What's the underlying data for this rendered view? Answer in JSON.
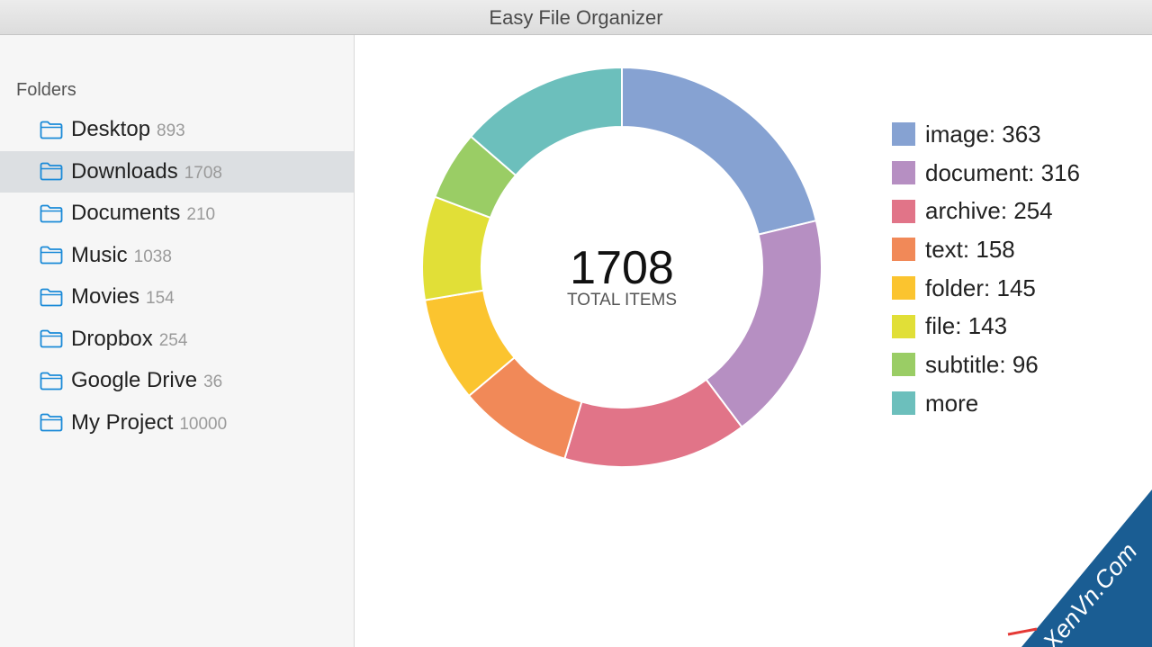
{
  "window": {
    "title": "Easy File Organizer"
  },
  "sidebar": {
    "header": "Folders",
    "folders": [
      {
        "name": "Desktop",
        "count": "893",
        "selected": false
      },
      {
        "name": "Downloads",
        "count": "1708",
        "selected": true
      },
      {
        "name": "Documents",
        "count": "210",
        "selected": false
      },
      {
        "name": "Music",
        "count": "1038",
        "selected": false
      },
      {
        "name": "Movies",
        "count": "154",
        "selected": false
      },
      {
        "name": "Dropbox",
        "count": "254",
        "selected": false
      },
      {
        "name": "Google Drive",
        "count": "36",
        "selected": false
      },
      {
        "name": "My Project",
        "count": "10000",
        "selected": false
      }
    ]
  },
  "summary": {
    "total": "1708",
    "label": "TOTAL ITEMS"
  },
  "chart_data": {
    "type": "pie",
    "variant": "donut",
    "center_value": "1708",
    "center_label": "TOTAL ITEMS",
    "categories": [
      "image",
      "document",
      "archive",
      "text",
      "folder",
      "file",
      "subtitle",
      "more"
    ],
    "values": [
      363,
      316,
      254,
      158,
      145,
      143,
      96,
      233
    ],
    "colors": [
      "#86a2d2",
      "#b68fc2",
      "#e17488",
      "#f18958",
      "#fbc42f",
      "#e1df37",
      "#9acd65",
      "#6cbfbc"
    ],
    "legend_labels": [
      "image: 363",
      "document: 316",
      "archive: 254",
      "text: 158",
      "folder: 145",
      "file: 143",
      "subtitle: 96",
      "more"
    ],
    "legend_position": "right"
  },
  "watermark": {
    "text": "XenVn.Com"
  }
}
